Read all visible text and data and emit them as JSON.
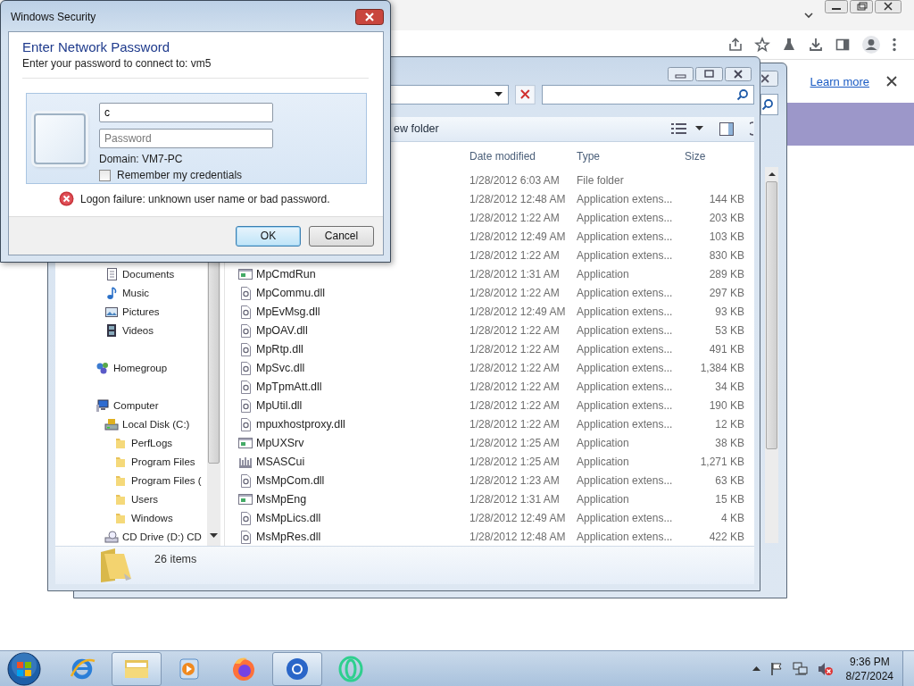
{
  "browser": {
    "link": "Learn more"
  },
  "explorer": {
    "toolbar_text": "ew folder",
    "columns": [
      "Date modified",
      "Type",
      "Size"
    ],
    "nav": [
      {
        "children": [
          {
            "label": "Documents",
            "kind": "documents"
          },
          {
            "label": "Music",
            "kind": "music"
          },
          {
            "label": "Pictures",
            "kind": "pictures"
          },
          {
            "label": "Videos",
            "kind": "videos"
          }
        ]
      },
      {
        "label": "Homegroup",
        "kind": "homegroup"
      },
      {
        "label": "Computer",
        "kind": "computer",
        "children": [
          {
            "label": "Local Disk (C:)",
            "kind": "disk",
            "children": [
              {
                "label": "PerfLogs",
                "kind": "folder"
              },
              {
                "label": "Program Files",
                "kind": "folder"
              },
              {
                "label": "Program Files (",
                "kind": "folder"
              },
              {
                "label": "Users",
                "kind": "folder"
              },
              {
                "label": "Windows",
                "kind": "folder"
              }
            ]
          },
          {
            "label": "CD Drive (D:) CD",
            "kind": "cd"
          }
        ]
      }
    ],
    "rows": [
      {
        "date": "1/28/2012 6:03 AM",
        "type": "File folder"
      },
      {
        "date": "1/28/2012 12:48 AM",
        "type": "Application extens...",
        "size": "144 KB"
      },
      {
        "date": "1/28/2012 1:22 AM",
        "type": "Application extens...",
        "size": "203 KB"
      },
      {
        "date": "1/28/2012 12:49 AM",
        "type": "Application extens...",
        "size": "103 KB"
      },
      {
        "date": "1/28/2012 1:22 AM",
        "type": "Application extens...",
        "size": "830 KB"
      },
      {
        "name": "MpCmdRun",
        "kind": "app",
        "date": "1/28/2012 1:31 AM",
        "type": "Application",
        "size": "289 KB"
      },
      {
        "name": "MpCommu.dll",
        "kind": "dll",
        "date": "1/28/2012 1:22 AM",
        "type": "Application extens...",
        "size": "297 KB"
      },
      {
        "name": "MpEvMsg.dll",
        "kind": "dll",
        "date": "1/28/2012 12:49 AM",
        "type": "Application extens...",
        "size": "93 KB"
      },
      {
        "name": "MpOAV.dll",
        "kind": "dll",
        "date": "1/28/2012 1:22 AM",
        "type": "Application extens...",
        "size": "53 KB"
      },
      {
        "name": "MpRtp.dll",
        "kind": "dll",
        "date": "1/28/2012 1:22 AM",
        "type": "Application extens...",
        "size": "491 KB"
      },
      {
        "name": "MpSvc.dll",
        "kind": "dll",
        "date": "1/28/2012 1:22 AM",
        "type": "Application extens...",
        "size": "1,384 KB"
      },
      {
        "name": "MpTpmAtt.dll",
        "kind": "dll",
        "date": "1/28/2012 1:22 AM",
        "type": "Application extens...",
        "size": "34 KB"
      },
      {
        "name": "MpUtil.dll",
        "kind": "dll",
        "date": "1/28/2012 1:22 AM",
        "type": "Application extens...",
        "size": "190 KB"
      },
      {
        "name": "mpuxhostproxy.dll",
        "kind": "dll",
        "date": "1/28/2012 1:22 AM",
        "type": "Application extens...",
        "size": "12 KB"
      },
      {
        "name": "MpUXSrv",
        "kind": "app",
        "date": "1/28/2012 1:25 AM",
        "type": "Application",
        "size": "38 KB"
      },
      {
        "name": "MSASCui",
        "kind": "bars",
        "date": "1/28/2012 1:25 AM",
        "type": "Application",
        "size": "1,271 KB"
      },
      {
        "name": "MsMpCom.dll",
        "kind": "dll",
        "date": "1/28/2012 1:23 AM",
        "type": "Application extens...",
        "size": "63 KB"
      },
      {
        "name": "MsMpEng",
        "kind": "app",
        "date": "1/28/2012 1:31 AM",
        "type": "Application",
        "size": "15 KB"
      },
      {
        "name": "MsMpLics.dll",
        "kind": "dll",
        "date": "1/28/2012 12:49 AM",
        "type": "Application extens...",
        "size": "4 KB"
      },
      {
        "name": "MsMpRes.dll",
        "kind": "dll",
        "date": "1/28/2012 12:48 AM",
        "type": "Application extens...",
        "size": "422 KB"
      }
    ],
    "status": "26 items"
  },
  "dialog": {
    "title": "Windows Security",
    "heading": "Enter Network Password",
    "subheading": "Enter your password to connect to: vm5",
    "username": "c",
    "password_placeholder": "Password",
    "domain": "Domain: VM7-PC",
    "remember": {
      "label": "Remember my credentials",
      "checked": false
    },
    "error": "Logon failure: unknown user name or bad password.",
    "buttons": [
      {
        "label": "OK",
        "default": true
      },
      {
        "label": "Cancel",
        "default": false
      }
    ]
  },
  "taskbar": {
    "apps": [
      {
        "kind": "ie",
        "active": false
      },
      {
        "kind": "explorer",
        "active": true
      },
      {
        "kind": "media",
        "active": false
      },
      {
        "kind": "firefox",
        "active": false
      },
      {
        "kind": "chrome",
        "active": true
      },
      {
        "kind": "ring",
        "active": false
      }
    ],
    "time": "9:36 PM",
    "date": "8/27/2024"
  }
}
